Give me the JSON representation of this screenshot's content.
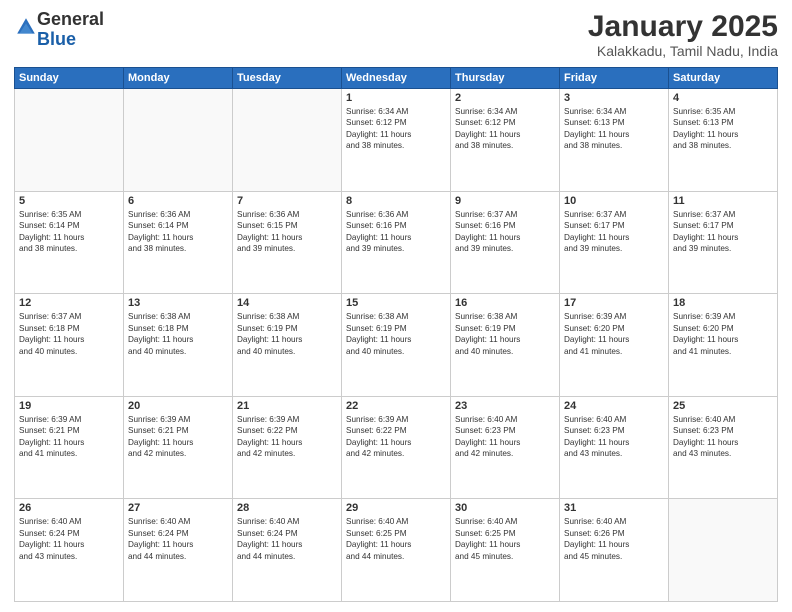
{
  "logo": {
    "general": "General",
    "blue": "Blue"
  },
  "title": {
    "month": "January 2025",
    "location": "Kalakkadu, Tamil Nadu, India"
  },
  "headers": [
    "Sunday",
    "Monday",
    "Tuesday",
    "Wednesday",
    "Thursday",
    "Friday",
    "Saturday"
  ],
  "weeks": [
    [
      {
        "day": "",
        "info": ""
      },
      {
        "day": "",
        "info": ""
      },
      {
        "day": "",
        "info": ""
      },
      {
        "day": "1",
        "info": "Sunrise: 6:34 AM\nSunset: 6:12 PM\nDaylight: 11 hours\nand 38 minutes."
      },
      {
        "day": "2",
        "info": "Sunrise: 6:34 AM\nSunset: 6:12 PM\nDaylight: 11 hours\nand 38 minutes."
      },
      {
        "day": "3",
        "info": "Sunrise: 6:34 AM\nSunset: 6:13 PM\nDaylight: 11 hours\nand 38 minutes."
      },
      {
        "day": "4",
        "info": "Sunrise: 6:35 AM\nSunset: 6:13 PM\nDaylight: 11 hours\nand 38 minutes."
      }
    ],
    [
      {
        "day": "5",
        "info": "Sunrise: 6:35 AM\nSunset: 6:14 PM\nDaylight: 11 hours\nand 38 minutes."
      },
      {
        "day": "6",
        "info": "Sunrise: 6:36 AM\nSunset: 6:14 PM\nDaylight: 11 hours\nand 38 minutes."
      },
      {
        "day": "7",
        "info": "Sunrise: 6:36 AM\nSunset: 6:15 PM\nDaylight: 11 hours\nand 39 minutes."
      },
      {
        "day": "8",
        "info": "Sunrise: 6:36 AM\nSunset: 6:16 PM\nDaylight: 11 hours\nand 39 minutes."
      },
      {
        "day": "9",
        "info": "Sunrise: 6:37 AM\nSunset: 6:16 PM\nDaylight: 11 hours\nand 39 minutes."
      },
      {
        "day": "10",
        "info": "Sunrise: 6:37 AM\nSunset: 6:17 PM\nDaylight: 11 hours\nand 39 minutes."
      },
      {
        "day": "11",
        "info": "Sunrise: 6:37 AM\nSunset: 6:17 PM\nDaylight: 11 hours\nand 39 minutes."
      }
    ],
    [
      {
        "day": "12",
        "info": "Sunrise: 6:37 AM\nSunset: 6:18 PM\nDaylight: 11 hours\nand 40 minutes."
      },
      {
        "day": "13",
        "info": "Sunrise: 6:38 AM\nSunset: 6:18 PM\nDaylight: 11 hours\nand 40 minutes."
      },
      {
        "day": "14",
        "info": "Sunrise: 6:38 AM\nSunset: 6:19 PM\nDaylight: 11 hours\nand 40 minutes."
      },
      {
        "day": "15",
        "info": "Sunrise: 6:38 AM\nSunset: 6:19 PM\nDaylight: 11 hours\nand 40 minutes."
      },
      {
        "day": "16",
        "info": "Sunrise: 6:38 AM\nSunset: 6:19 PM\nDaylight: 11 hours\nand 40 minutes."
      },
      {
        "day": "17",
        "info": "Sunrise: 6:39 AM\nSunset: 6:20 PM\nDaylight: 11 hours\nand 41 minutes."
      },
      {
        "day": "18",
        "info": "Sunrise: 6:39 AM\nSunset: 6:20 PM\nDaylight: 11 hours\nand 41 minutes."
      }
    ],
    [
      {
        "day": "19",
        "info": "Sunrise: 6:39 AM\nSunset: 6:21 PM\nDaylight: 11 hours\nand 41 minutes."
      },
      {
        "day": "20",
        "info": "Sunrise: 6:39 AM\nSunset: 6:21 PM\nDaylight: 11 hours\nand 42 minutes."
      },
      {
        "day": "21",
        "info": "Sunrise: 6:39 AM\nSunset: 6:22 PM\nDaylight: 11 hours\nand 42 minutes."
      },
      {
        "day": "22",
        "info": "Sunrise: 6:39 AM\nSunset: 6:22 PM\nDaylight: 11 hours\nand 42 minutes."
      },
      {
        "day": "23",
        "info": "Sunrise: 6:40 AM\nSunset: 6:23 PM\nDaylight: 11 hours\nand 42 minutes."
      },
      {
        "day": "24",
        "info": "Sunrise: 6:40 AM\nSunset: 6:23 PM\nDaylight: 11 hours\nand 43 minutes."
      },
      {
        "day": "25",
        "info": "Sunrise: 6:40 AM\nSunset: 6:23 PM\nDaylight: 11 hours\nand 43 minutes."
      }
    ],
    [
      {
        "day": "26",
        "info": "Sunrise: 6:40 AM\nSunset: 6:24 PM\nDaylight: 11 hours\nand 43 minutes."
      },
      {
        "day": "27",
        "info": "Sunrise: 6:40 AM\nSunset: 6:24 PM\nDaylight: 11 hours\nand 44 minutes."
      },
      {
        "day": "28",
        "info": "Sunrise: 6:40 AM\nSunset: 6:24 PM\nDaylight: 11 hours\nand 44 minutes."
      },
      {
        "day": "29",
        "info": "Sunrise: 6:40 AM\nSunset: 6:25 PM\nDaylight: 11 hours\nand 44 minutes."
      },
      {
        "day": "30",
        "info": "Sunrise: 6:40 AM\nSunset: 6:25 PM\nDaylight: 11 hours\nand 45 minutes."
      },
      {
        "day": "31",
        "info": "Sunrise: 6:40 AM\nSunset: 6:26 PM\nDaylight: 11 hours\nand 45 minutes."
      },
      {
        "day": "",
        "info": ""
      }
    ]
  ]
}
